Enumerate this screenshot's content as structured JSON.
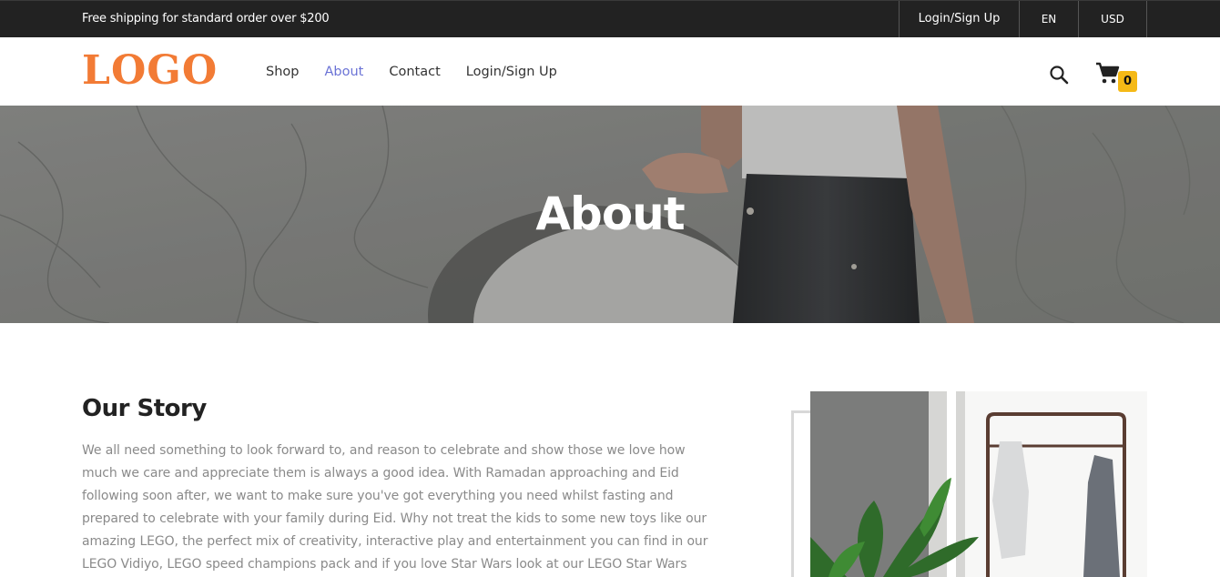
{
  "topbar": {
    "promo": "Free shipping for standard order over $200",
    "login": "Login/Sign Up",
    "language": "EN",
    "currency": "USD"
  },
  "header": {
    "logo": "LOGO",
    "nav": [
      {
        "label": "Shop",
        "active": false
      },
      {
        "label": "About",
        "active": true
      },
      {
        "label": "Contact",
        "active": false
      },
      {
        "label": "Login/Sign Up",
        "active": false
      }
    ],
    "search_icon": "search-icon",
    "cart_icon": "cart-icon",
    "cart_count": "0"
  },
  "hero": {
    "title": "About"
  },
  "story": {
    "title": "Our Story",
    "text": "We all need something to look forward to, and reason to celebrate and show those we love how much we care and appreciate them is always a good idea. With Ramadan approaching and Eid following soon after, we want to make sure you've got everything you need whilst fasting and prepared to celebrate with your family during Eid. Why not treat the kids to some new toys like our amazing LEGO, the perfect mix of creativity, interactive play and entertainment you can find in our LEGO Vidiyo, LEGO speed champions pack and if you love Star Wars look at our LEGO Star Wars"
  },
  "colors": {
    "topbar_bg": "#222222",
    "logo": "#f27b35",
    "nav_active": "#6b73d6",
    "badge": "#f5b916"
  }
}
